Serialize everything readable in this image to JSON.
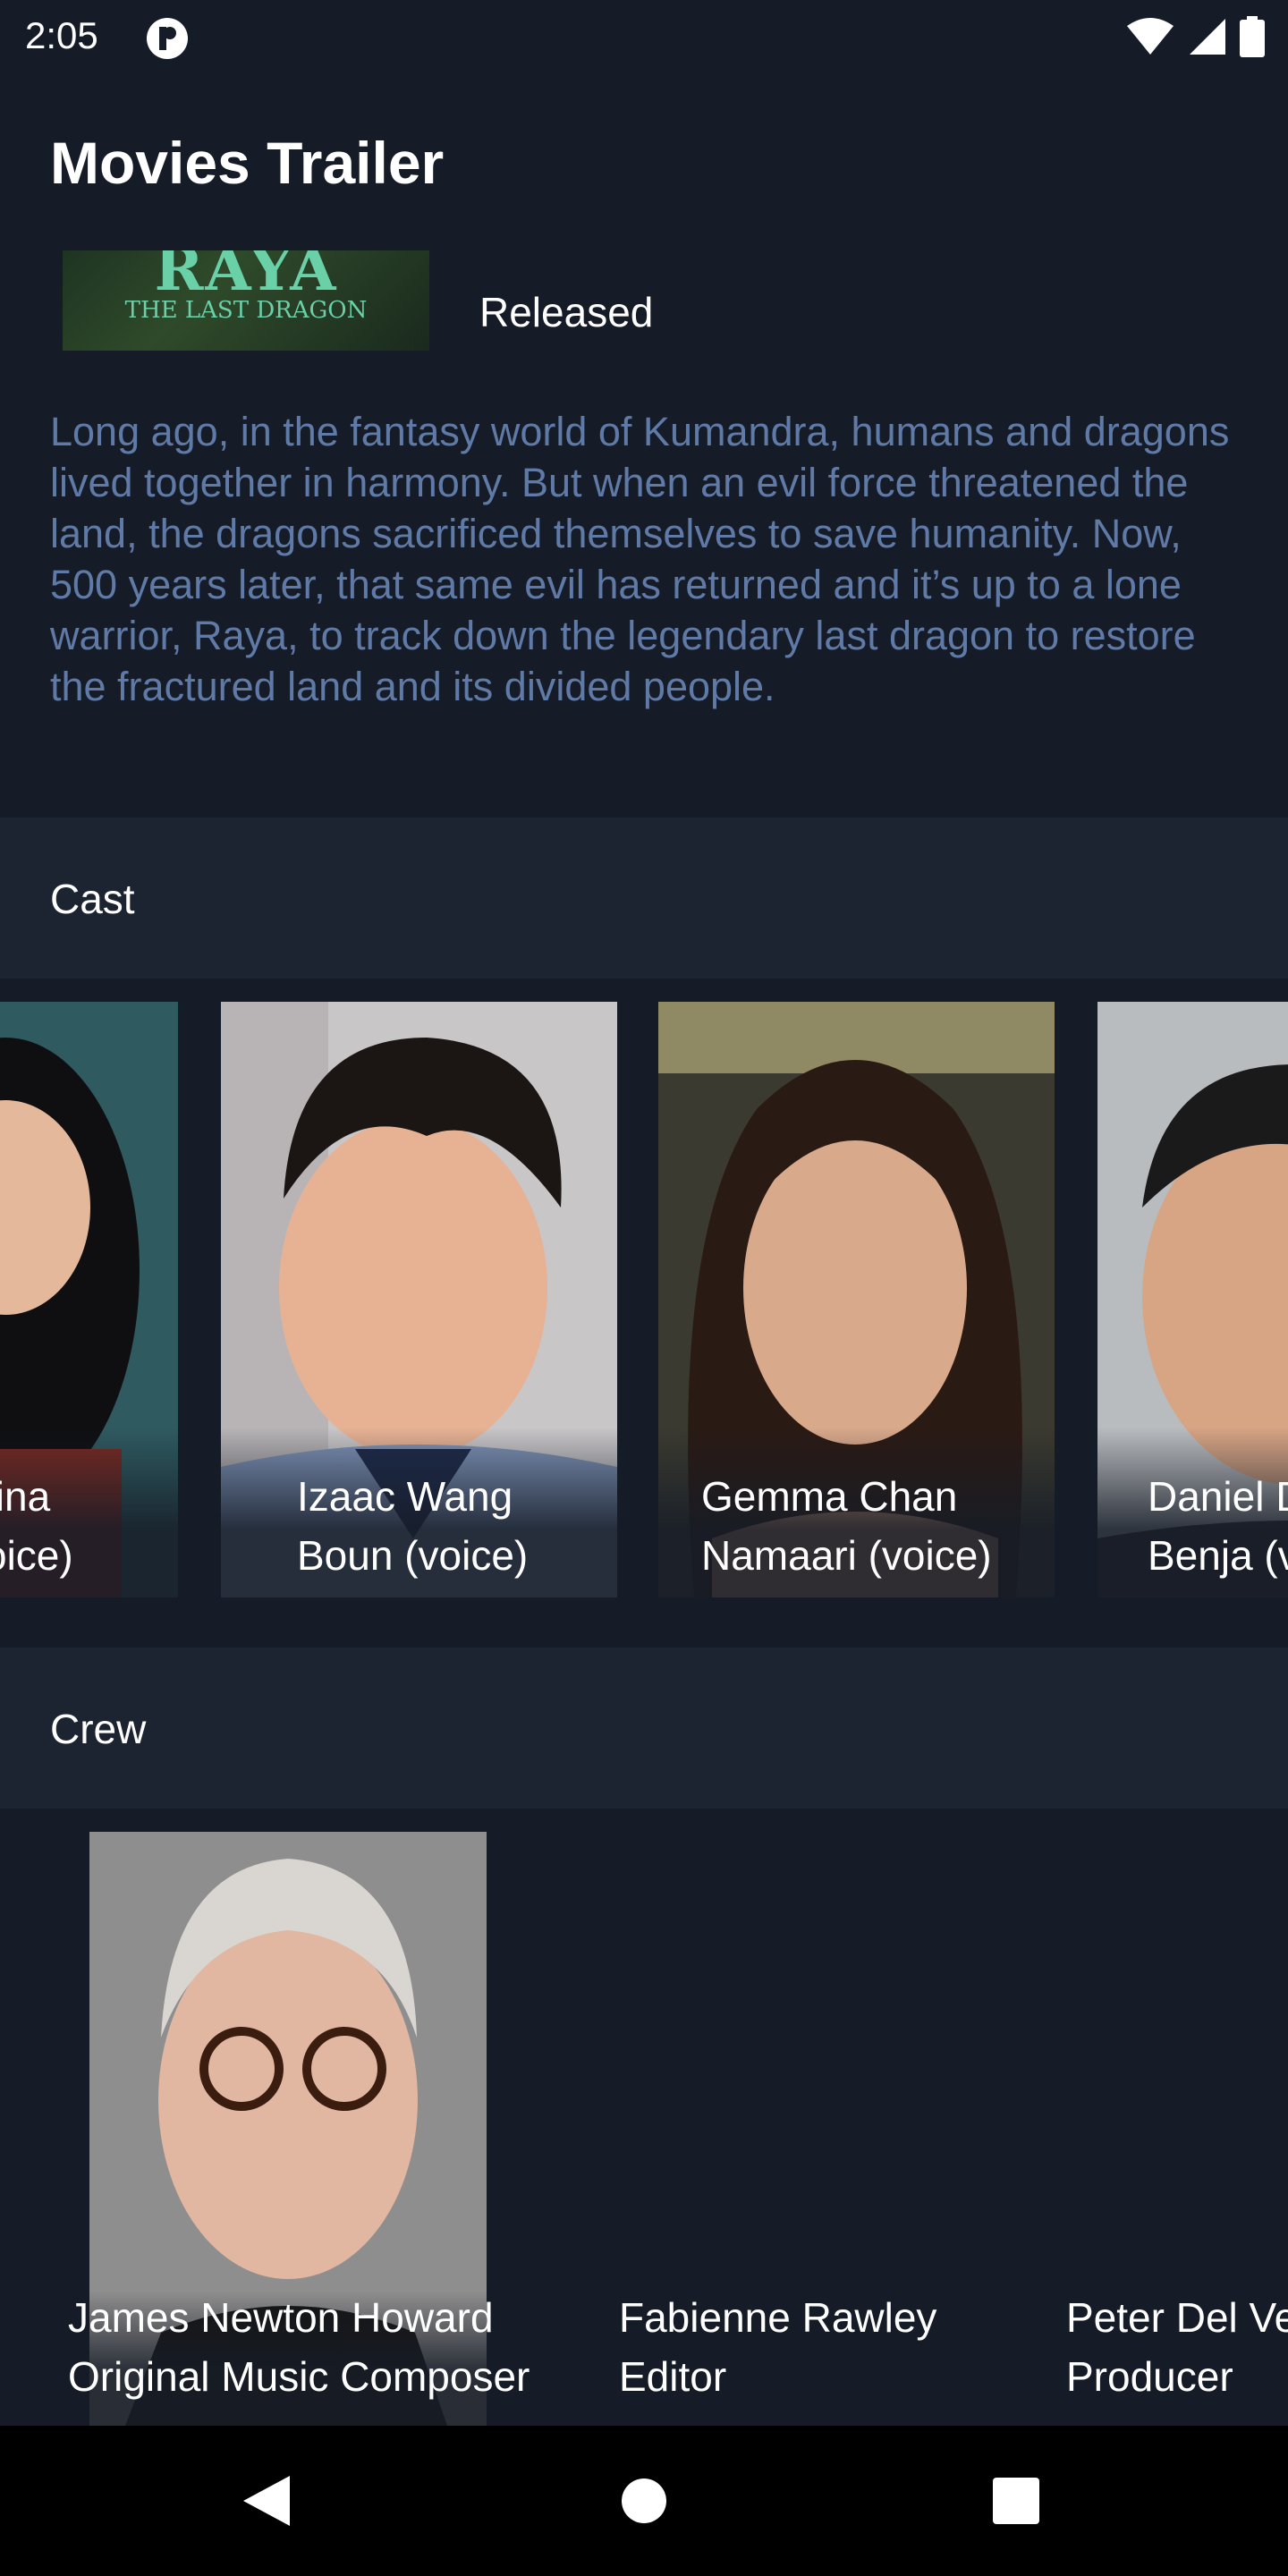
{
  "status_bar": {
    "time": "2:05"
  },
  "app_bar": {
    "title": "Movies Trailer"
  },
  "movie": {
    "poster_title": "RAYA",
    "poster_subtitle": "THE LAST DRAGON",
    "status": "Released",
    "overview": "Long ago, in the fantasy world of Kumandra, humans and dragons lived together in harmony. But when an evil force threatened the land, the dragons sacrificed themselves to save humanity. Now, 500 years later, that same evil has returned and it’s up to a lone warrior, Raya, to track down the legendary last dragon to restore the fractured land and its divided people."
  },
  "cast": {
    "header": "Cast",
    "members": [
      {
        "name": "fina",
        "role": "oice)"
      },
      {
        "name": "Izaac Wang",
        "role": "Boun (voice)"
      },
      {
        "name": "Gemma Chan",
        "role": "Namaari (voice)"
      },
      {
        "name": "Daniel D",
        "role": "Benja (v"
      }
    ]
  },
  "crew": {
    "header": "Crew",
    "members": [
      {
        "name": "James Newton Howard",
        "job": "Original Music Composer"
      },
      {
        "name": "Fabienne Rawley",
        "job": "Editor"
      },
      {
        "name": "Peter Del Ve",
        "job": "Producer"
      }
    ]
  },
  "colors": {
    "background": "#161c27",
    "section_header": "#1c2431",
    "overview_text": "#5f7aa6"
  }
}
